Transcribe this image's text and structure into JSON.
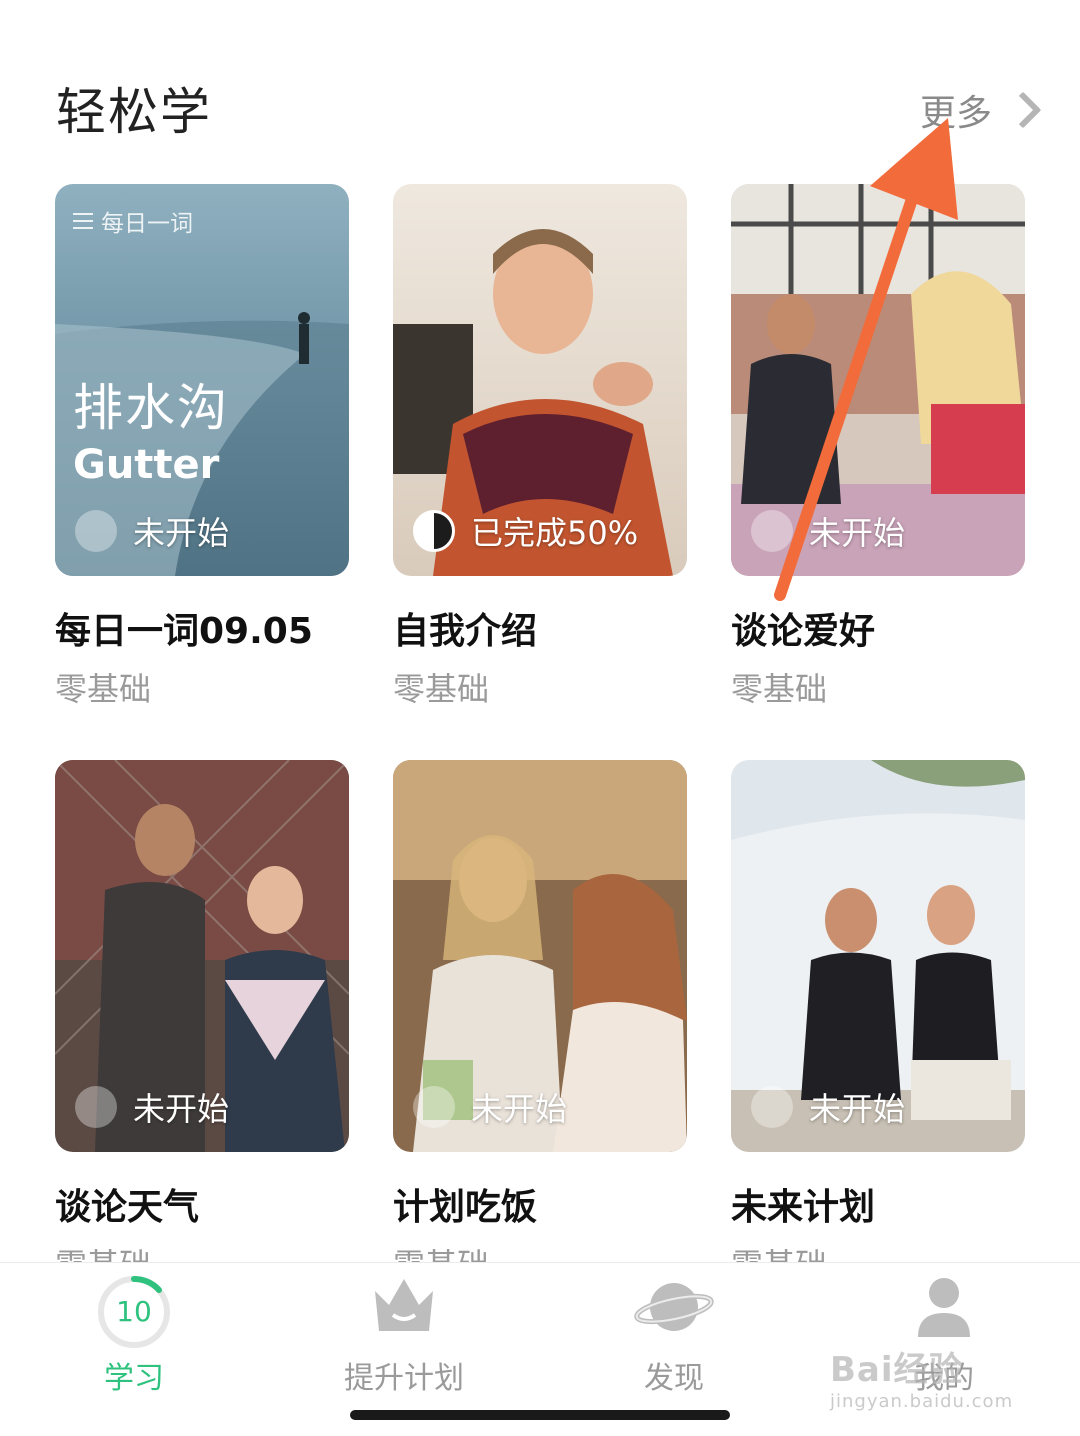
{
  "header": {
    "title": "轻松学",
    "more_label": "更多"
  },
  "cards": [
    {
      "title": "每日一词09.05",
      "level": "零基础",
      "status": "未开始",
      "tag": "每日一词",
      "word_cn": "排水沟",
      "word_en": "Gutter"
    },
    {
      "title": "自我介绍",
      "level": "零基础",
      "status": "已完成50%"
    },
    {
      "title": "谈论爱好",
      "level": "零基础",
      "status": "未开始"
    },
    {
      "title": "谈论天气",
      "level": "零基础",
      "status": "未开始"
    },
    {
      "title": "计划吃饭",
      "level": "零基础",
      "status": "未开始"
    },
    {
      "title": "未来计划",
      "level": "零基础",
      "status": "未开始"
    }
  ],
  "tabbar": {
    "tabs": [
      {
        "label": "学习",
        "active": true,
        "icon": "progress-ring-icon",
        "ring_number": "10"
      },
      {
        "label": "提升计划",
        "active": false,
        "icon": "crown-icon"
      },
      {
        "label": "发现",
        "active": false,
        "icon": "planet-icon"
      },
      {
        "label": "我的",
        "active": false,
        "icon": "person-icon"
      }
    ]
  },
  "watermark": {
    "logo": "Bai经验",
    "sub": "jingyan.baidu.com"
  },
  "colors": {
    "accent": "#2ec27e",
    "annotation_arrow": "#f26b3a"
  }
}
